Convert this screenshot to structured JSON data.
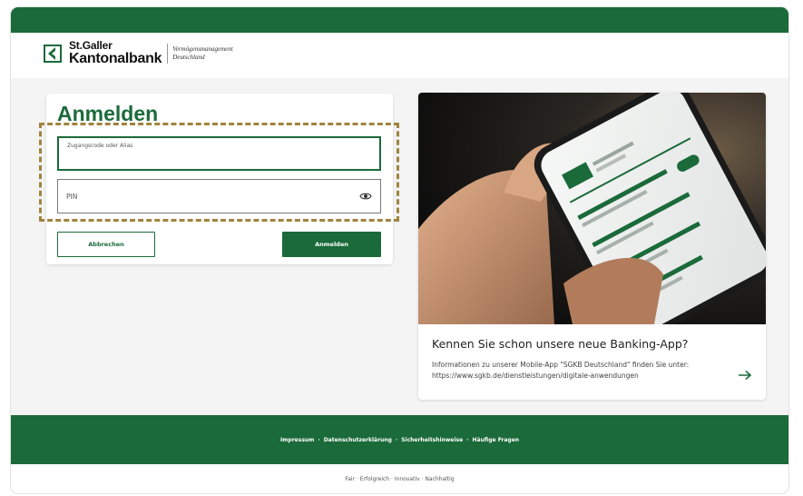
{
  "brand": {
    "name_line1": "St.Galler",
    "name_line2": "Kantonalbank",
    "sub_line1": "Vermögensmanagement",
    "sub_line2": "Deutschland"
  },
  "login": {
    "title": "Anmelden",
    "access_label": "Zugangscode oder Alias",
    "access_value": "",
    "pin_placeholder": "PIN",
    "cancel_label": "Abbrechen",
    "submit_label": "Anmelden"
  },
  "promo": {
    "title": "Kennen Sie schon unsere neue Banking-App?",
    "text_line1": "Informationen zu unserer Mobile-App \"SGKB Deutschland\" finden Sie unter:",
    "text_line2": "https://www.sgkb.de/dienstleistungen/digitale-anwendungen"
  },
  "footer": {
    "links": [
      "Impressum",
      "Datenschutzerklärung",
      "Sicherheitshinweise",
      "Häufige Fragen"
    ],
    "separator": "·",
    "tagline": "Fair · Erfolgreich · Innovativ · Nachhaltig"
  },
  "colors": {
    "brand_green": "#1b6a3a",
    "highlight": "#a0843e"
  },
  "icons": {
    "logo": "sgkb-logo-icon",
    "eye": "eye-icon",
    "arrow": "arrow-right-icon"
  }
}
